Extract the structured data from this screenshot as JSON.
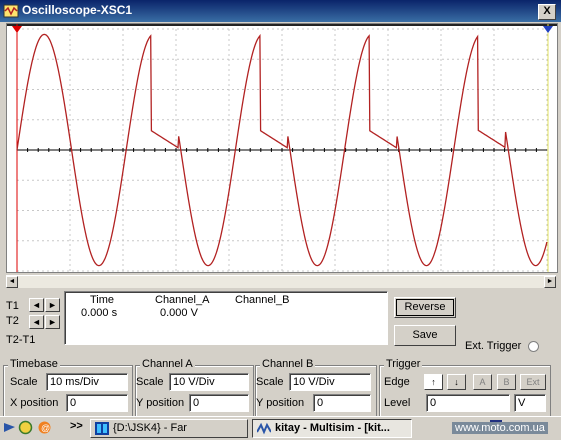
{
  "window": {
    "title": "Oscilloscope-XSC1",
    "close_label": "X"
  },
  "cursors": {
    "t1": "T1",
    "t2": "T2",
    "t2_t1": "T2-T1"
  },
  "readout": {
    "headers": [
      "Time",
      "Channel_A",
      "Channel_B"
    ],
    "time": "0.000 s",
    "channel_a": "0.000 V"
  },
  "buttons": {
    "reverse": "Reverse",
    "save": "Save",
    "ext_trigger": "Ext. Trigger"
  },
  "timebase": {
    "title": "Timebase",
    "scale_label": "Scale",
    "scale": "10 ms/Div",
    "xpos_label": "X position",
    "xpos": "0"
  },
  "channel_a": {
    "title": "Channel A",
    "scale_label": "Scale",
    "scale": "10  V/Div",
    "ypos_label": "Y position",
    "ypos": "0"
  },
  "channel_b": {
    "title": "Channel B",
    "scale_label": "Scale",
    "scale": "10  V/Div",
    "ypos_label": "Y position",
    "ypos": "0"
  },
  "trigger": {
    "title": "Trigger",
    "edge_label": "Edge",
    "level_label": "Level",
    "level": "0",
    "unit": "V",
    "buttons": [
      "A",
      "B",
      "Ext"
    ]
  },
  "taskbar": {
    "quicklaunch": ">>",
    "task1": "{D:\\JSK4} - Far",
    "task2": "kitay - Multisim - [kit...",
    "watermark": "www.moto.com.ua"
  },
  "colors": {
    "trace": "#b22222",
    "grid": "#c8c8c8",
    "title_bar": "#0a246a"
  }
}
